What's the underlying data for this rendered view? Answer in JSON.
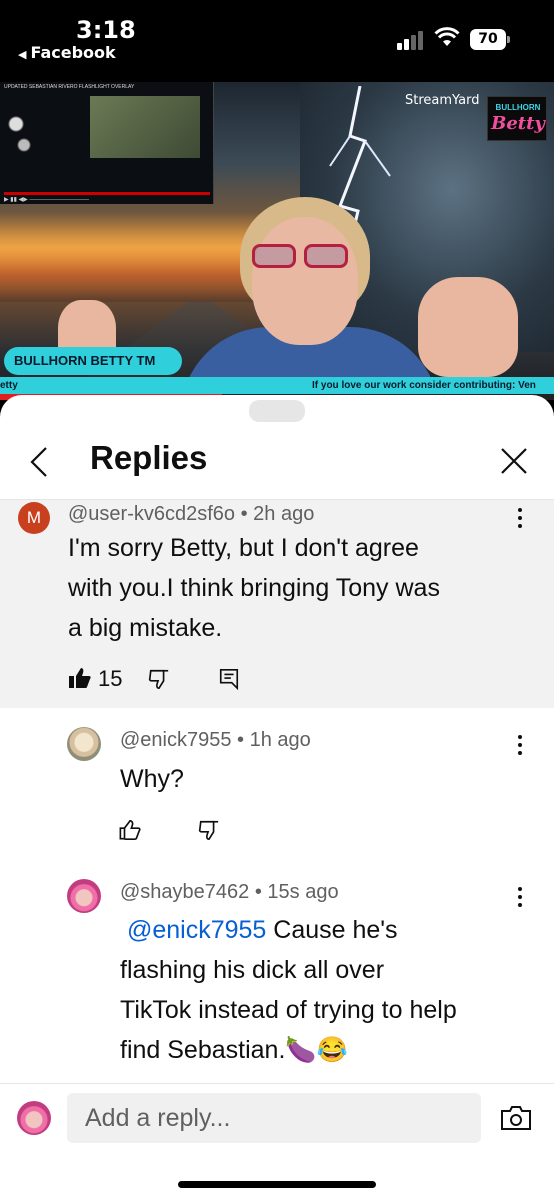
{
  "status_bar": {
    "time": "3:18",
    "back_app": "Facebook",
    "battery": "70"
  },
  "video": {
    "inset_title": "UPDATED SEBASTIAN RIVERO FLASHLIGHT OVERLAY",
    "platform": "StreamYard",
    "brand_top": "BULLHORN",
    "brand_bottom": "Betty",
    "name_tag": "BULLHORN BETTY TM",
    "ticker_left": "etty",
    "ticker_right": "If you love our work consider contributing: Ven",
    "progress": 0.4
  },
  "sheet": {
    "title": "Replies",
    "parent_comment": {
      "avatar_letter": "M",
      "author": "@user-kv6cd2sf6o",
      "time": "2h ago",
      "lines": [
        "I'm sorry Betty, but I don't agree",
        "with you.I  think bringing Tony was",
        "a big mistake."
      ],
      "likes": "15"
    },
    "replies": [
      {
        "author": "@enick7955",
        "time": "1h ago",
        "text": "Why?"
      },
      {
        "author": "@shaybe7462",
        "time": "15s ago",
        "mention": "@enick7955",
        "line1_rest": " Cause he's",
        "line2": "flashing his dick all over",
        "line3": "TikTok instead of trying to help",
        "line4": "find Sebastian.🍆😂"
      }
    ],
    "reply_placeholder": "Add a reply..."
  },
  "colors": {
    "accent_cyan": "#2fd0dc",
    "mention_blue": "#065fd4",
    "avatar_m": "#c8401e"
  },
  "icons": [
    "chevron-left-icon",
    "close-icon",
    "more-vert-icon",
    "thumb-up-icon",
    "thumb-down-icon",
    "reply-icon",
    "camera-icon",
    "signal-icon",
    "wifi-icon",
    "battery-icon"
  ]
}
